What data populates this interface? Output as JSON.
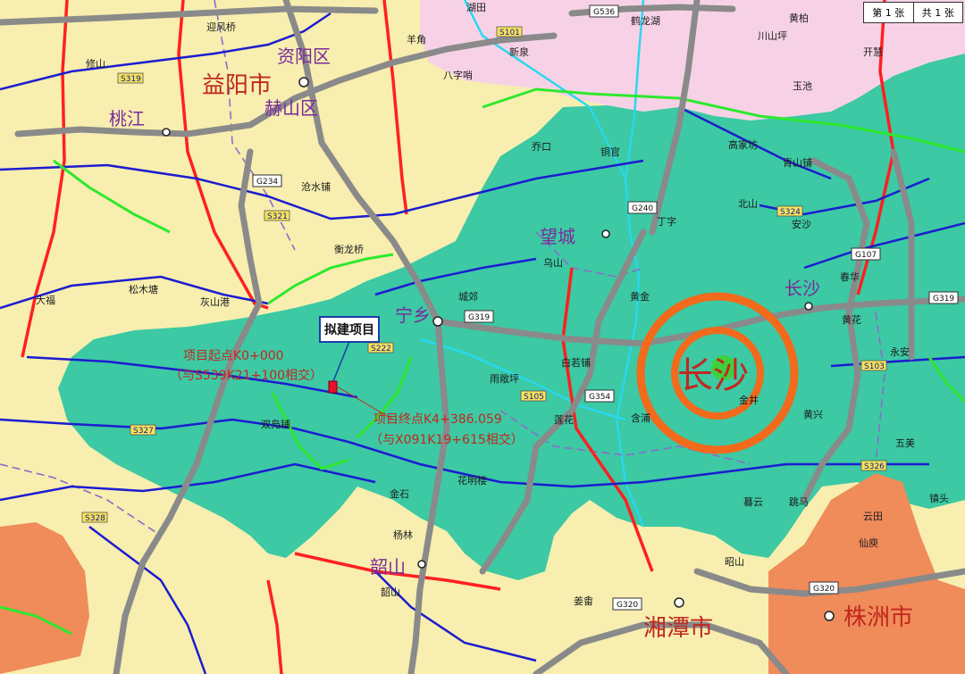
{
  "sheet": {
    "current": "第 1 张",
    "total": "共 1 张"
  },
  "colors": {
    "yellow_zone": "#f7eeaf",
    "pink_zone": "#f7d2e6",
    "teal_zone": "#3cc9a4",
    "orange_zone": "#f08b5a",
    "expressway": "#8a8a8a",
    "national_road": "#ff2020",
    "provincial_road": "#1c1cd0",
    "county_road": "#2ee82e",
    "river": "#28d8ee",
    "boundary": "#8c6cc8",
    "target_ring": "#f26a1c"
  },
  "cities": {
    "yiyang": "益阳市",
    "heshan": "赫山区",
    "ziyang": "资阳区",
    "taojiang": "桃江",
    "wangcheng": "望城",
    "ningxiang": "宁乡",
    "changsha_city": "长沙",
    "changsha_county": "长沙",
    "xiangtan": "湘潭市",
    "zhuzhou": "株洲市",
    "shaoshan": "韶山"
  },
  "places": [
    "羊角",
    "新泉",
    "迎风桥",
    "八字哨",
    "鹤龙湖",
    "修山",
    "沧水铺",
    "衡龙桥",
    "灰山港",
    "松木塘",
    "大福",
    "乔口",
    "铜官",
    "北山",
    "安沙",
    "丁字",
    "乌山",
    "白若铺",
    "黄金",
    "城郊",
    "莲花",
    "含浦",
    "雨敞坪",
    "双凫铺",
    "花明楼",
    "金石",
    "杨林",
    "韶山",
    "姜畬",
    "昭山",
    "暮云",
    "跳马",
    "黄兴",
    "五美",
    "镇头",
    "云田",
    "仙庾",
    "黄花",
    "永安",
    "春华",
    "高家坊",
    "青山铺",
    "金井",
    "玉池",
    "开慧",
    "黄柏",
    "湖田",
    "川山坪"
  ],
  "roads": [
    "G536",
    "G234",
    "G319",
    "G240",
    "G354",
    "G320",
    "G107",
    "S319",
    "S321",
    "S326",
    "S327",
    "S328",
    "S324",
    "S222",
    "S101",
    "S103",
    "S105"
  ],
  "annotations": {
    "project": "拟建项目",
    "start_line1": "项目起点K0+000",
    "start_line2": "（与S539K21+100相交）",
    "end_line1": "项目终点K4+386.059",
    "end_line2": "（与X091K19+615相交）"
  }
}
